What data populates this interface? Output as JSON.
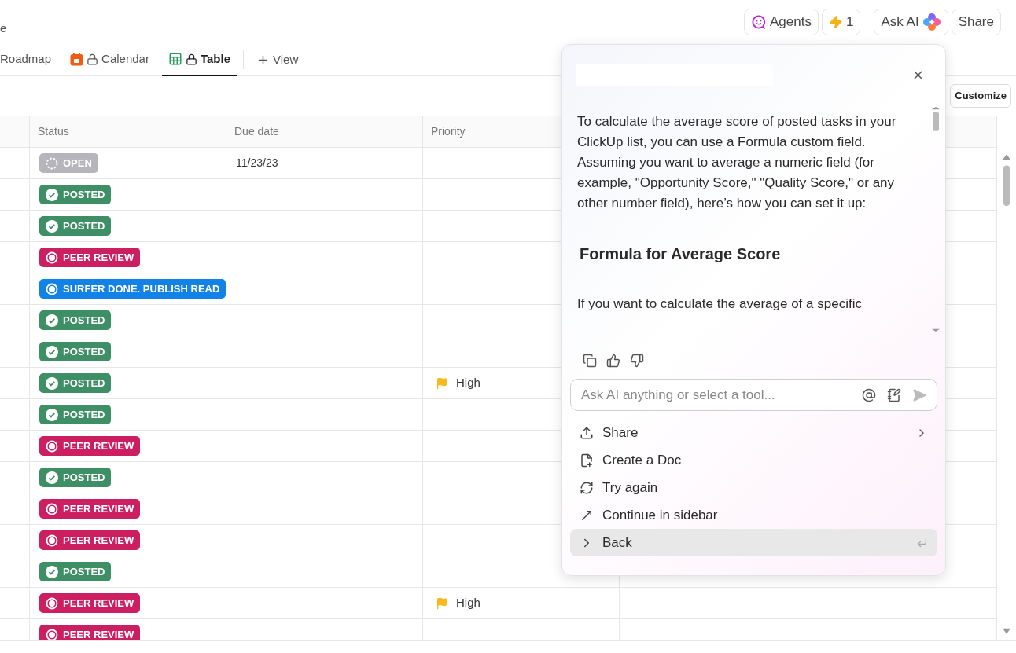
{
  "page_title": "e",
  "header_buttons": [
    {
      "kind": "agents",
      "label": "Agents"
    },
    {
      "kind": "bolt",
      "label": "1"
    },
    {
      "kind": "askai",
      "label": "Ask AI"
    },
    {
      "kind": "share",
      "label": "Share"
    }
  ],
  "tabs": [
    {
      "label": "Roadmap",
      "kind": "plain",
      "locked": false,
      "selected": false
    },
    {
      "label": "Calendar",
      "kind": "calendar",
      "locked": true,
      "selected": false
    },
    {
      "label": "Table",
      "kind": "table",
      "locked": true,
      "selected": true
    }
  ],
  "add_view": "View",
  "customize": "Customize",
  "table": {
    "columns": [
      "Status",
      "Due date",
      "Priority"
    ],
    "rows": [
      {
        "status": {
          "label": "OPEN",
          "kind": "open",
          "color": "#b5b5bb"
        },
        "due": "11/23/23"
      },
      {
        "status": {
          "label": "POSTED",
          "kind": "done",
          "color": "#3f8f66"
        }
      },
      {
        "status": {
          "label": "POSTED",
          "kind": "done",
          "color": "#3f8f66"
        }
      },
      {
        "status": {
          "label": "PEER REVIEW",
          "kind": "active",
          "color": "#cc1f62"
        }
      },
      {
        "status": {
          "label": "SURFER DONE. PUBLISH READ",
          "kind": "active",
          "color": "#1382e6"
        }
      },
      {
        "status": {
          "label": "POSTED",
          "kind": "done",
          "color": "#3f8f66"
        }
      },
      {
        "status": {
          "label": "POSTED",
          "kind": "done",
          "color": "#3f8f66"
        }
      },
      {
        "status": {
          "label": "POSTED",
          "kind": "done",
          "color": "#3f8f66"
        },
        "priority": "High"
      },
      {
        "status": {
          "label": "POSTED",
          "kind": "done",
          "color": "#3f8f66"
        }
      },
      {
        "status": {
          "label": "PEER REVIEW",
          "kind": "active",
          "color": "#cc1f62"
        }
      },
      {
        "status": {
          "label": "POSTED",
          "kind": "done",
          "color": "#3f8f66"
        }
      },
      {
        "status": {
          "label": "PEER REVIEW",
          "kind": "active",
          "color": "#cc1f62"
        }
      },
      {
        "status": {
          "label": "PEER REVIEW",
          "kind": "active",
          "color": "#cc1f62"
        }
      },
      {
        "status": {
          "label": "POSTED",
          "kind": "done",
          "color": "#3f8f66"
        }
      },
      {
        "status": {
          "label": "PEER REVIEW",
          "kind": "active",
          "color": "#cc1f62"
        },
        "priority": "High"
      },
      {
        "status": {
          "label": "PEER REVIEW",
          "kind": "active",
          "color": "#cc1f62"
        }
      }
    ]
  },
  "ai_popup": {
    "paragraphs": [
      {
        "kind": "text",
        "text": "To calculate the average score of posted tasks in your ClickUp list, you can use a Formula custom field. Assuming you want to average a numeric field (for example, \"Opportunity Score,\" \"Quality Score,\" or any other number field), here’s how you can set it up:"
      },
      {
        "kind": "heading",
        "text": "Formula for Average Score"
      },
      {
        "kind": "text",
        "text": "If you want to calculate the average of a specific"
      }
    ],
    "input_placeholder": "Ask AI anything or select a tool...",
    "actions": [
      {
        "kind": "share",
        "label": "Share",
        "submenu": true,
        "selected": false
      },
      {
        "kind": "doc",
        "label": "Create a Doc",
        "submenu": false,
        "selected": false
      },
      {
        "kind": "retry",
        "label": "Try again",
        "submenu": false,
        "selected": false
      },
      {
        "kind": "sidebar",
        "label": "Continue in sidebar",
        "submenu": false,
        "selected": false
      },
      {
        "kind": "back",
        "label": "Back",
        "submenu": false,
        "selected": true
      }
    ]
  }
}
